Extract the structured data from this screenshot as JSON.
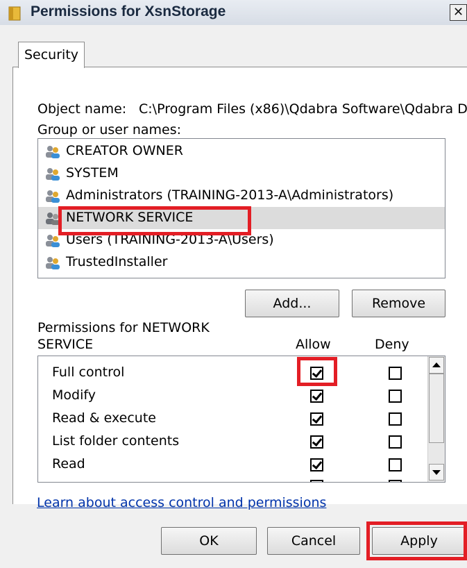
{
  "window": {
    "title": "Permissions for XsnStorage",
    "close_glyph": "✕",
    "icon": "folder-icon"
  },
  "tabs": [
    {
      "label": "Security"
    }
  ],
  "object": {
    "label": "Object name:",
    "value": "C:\\Program Files (x86)\\Qdabra Software\\Qdabra D"
  },
  "groups": {
    "label": "Group or user names:",
    "items": [
      {
        "label": "CREATOR OWNER",
        "icon": "users-icon"
      },
      {
        "label": "SYSTEM",
        "icon": "users-icon"
      },
      {
        "label": "Administrators (TRAINING-2013-A\\Administrators)",
        "icon": "users-icon"
      },
      {
        "label": "NETWORK SERVICE",
        "icon": "users-icon",
        "selected": true
      },
      {
        "label": "Users (TRAINING-2013-A\\Users)",
        "icon": "users-icon"
      },
      {
        "label": "TrustedInstaller",
        "icon": "users-icon"
      }
    ]
  },
  "buttons": {
    "add": "Add...",
    "remove": "Remove",
    "ok": "OK",
    "cancel": "Cancel",
    "apply": "Apply"
  },
  "permissions": {
    "header_line1": "Permissions for NETWORK",
    "header_line2": "SERVICE",
    "allow_label": "Allow",
    "deny_label": "Deny",
    "rows": [
      {
        "name": "Full control",
        "allow": true,
        "deny": false
      },
      {
        "name": "Modify",
        "allow": true,
        "deny": false
      },
      {
        "name": "Read & execute",
        "allow": true,
        "deny": false
      },
      {
        "name": "List folder contents",
        "allow": true,
        "deny": false
      },
      {
        "name": "Read",
        "allow": true,
        "deny": false
      }
    ]
  },
  "learn_link": "Learn about access control and permissions",
  "colors": {
    "highlight": "#e31e25",
    "link": "#0033aa",
    "selection": "#dcdcdc"
  }
}
